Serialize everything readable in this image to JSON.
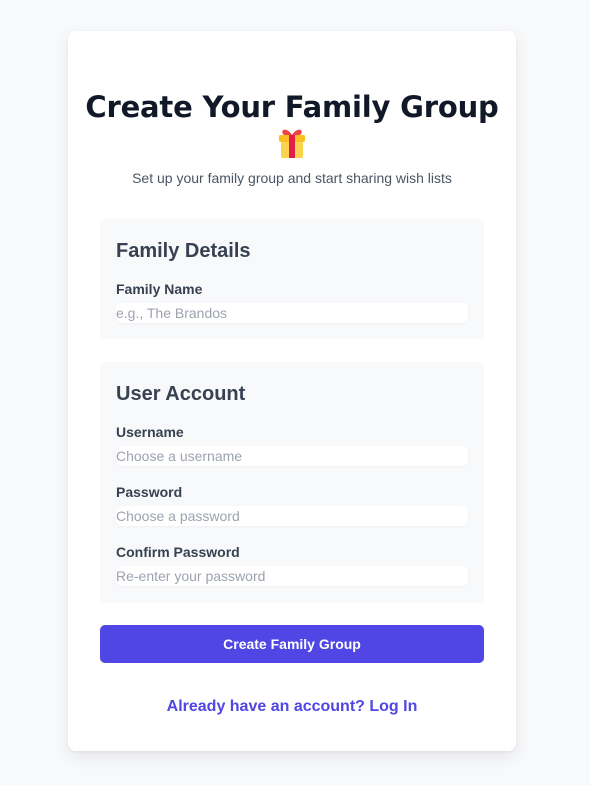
{
  "header": {
    "title": "Create Your Family Group",
    "icon": "gift-icon",
    "subtitle": "Set up your family group and start sharing wish lists"
  },
  "family_details": {
    "heading": "Family Details",
    "family_name_label": "Family Name",
    "family_name_placeholder": "e.g., The Brandos",
    "family_name_value": ""
  },
  "user_account": {
    "heading": "User Account",
    "username_label": "Username",
    "username_placeholder": "Choose a username",
    "password_label": "Password",
    "password_placeholder": "Choose a password",
    "confirm_label": "Confirm Password",
    "confirm_placeholder": "Re-enter your password"
  },
  "actions": {
    "submit_label": "Create Family Group",
    "login_link": "Already have an account? Log In"
  },
  "colors": {
    "accent": "#4f46e5",
    "background": "#f8f9fb",
    "card": "#ffffff"
  }
}
